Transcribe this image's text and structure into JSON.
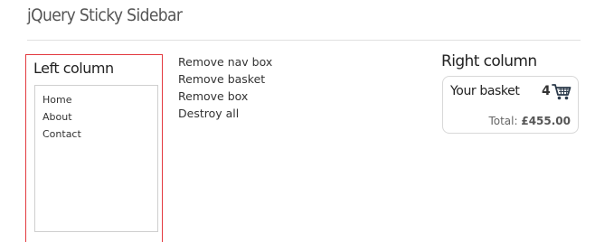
{
  "header": {
    "title": "jQuery Sticky Sidebar"
  },
  "left_column": {
    "heading": "Left column",
    "nav_items": [
      "Home",
      "About",
      "Contact"
    ]
  },
  "actions": {
    "remove_nav_box": "Remove nav box",
    "remove_basket": "Remove basket",
    "remove_box": "Remove box",
    "destroy_all": "Destroy all"
  },
  "right_column": {
    "heading": "Right column",
    "basket": {
      "title": "Your basket",
      "count": "4",
      "total_label": "Total:",
      "total_amount": "£455.00",
      "icon": "shopping-cart-icon"
    }
  },
  "colors": {
    "left_column_border": "#e3393f",
    "box_border": "#cfcfcf",
    "divider": "#e0e0e0"
  }
}
